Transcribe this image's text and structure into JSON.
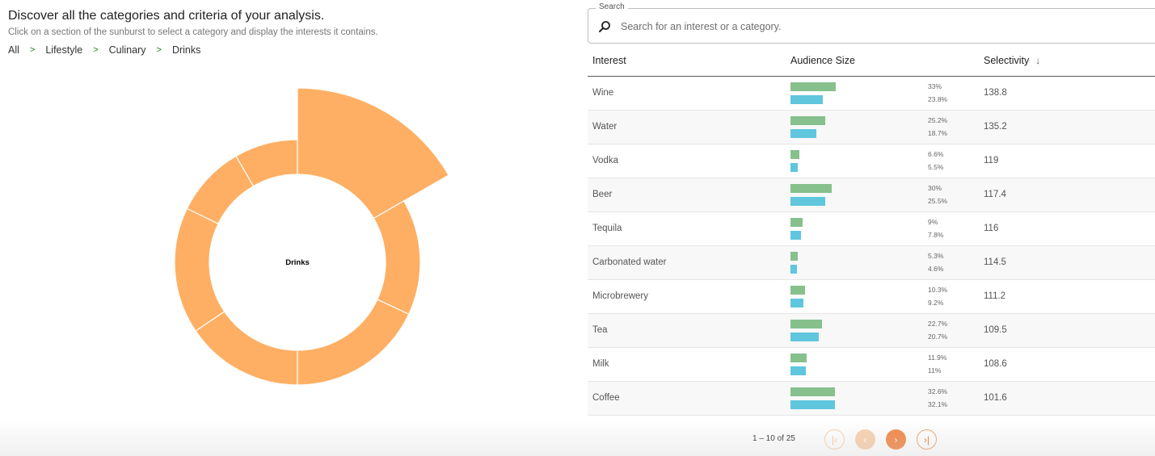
{
  "header": {
    "title": "Discover all the categories and criteria of your analysis.",
    "subtitle": "Click on a section of the sunburst to select a category and display the interests it contains."
  },
  "breadcrumb": {
    "items": [
      "All",
      "Lifestyle",
      "Culinary",
      "Drinks"
    ],
    "separator": ">"
  },
  "sunburst": {
    "center_label": "Drinks",
    "color": "#feaf63",
    "segment_count": 7,
    "selected_segment": 0
  },
  "search": {
    "legend": "Search",
    "placeholder": "Search for an interest or a category.",
    "value": "",
    "icon": "search-icon"
  },
  "table": {
    "columns": [
      "Interest",
      "Audience Size",
      "Selectivity"
    ],
    "sort_icon": "arrow-down-icon",
    "bar_colors": {
      "top": "#86c08d",
      "bottom": "#5fc6de"
    },
    "rows": [
      {
        "interest": "Wine",
        "pct_top": "33%",
        "pct_bottom": "23.8%",
        "selectivity": "138.8"
      },
      {
        "interest": "Water",
        "pct_top": "25.2%",
        "pct_bottom": "18.7%",
        "selectivity": "135.2"
      },
      {
        "interest": "Vodka",
        "pct_top": "6.6%",
        "pct_bottom": "5.5%",
        "selectivity": "119"
      },
      {
        "interest": "Beer",
        "pct_top": "30%",
        "pct_bottom": "25.5%",
        "selectivity": "117.4"
      },
      {
        "interest": "Tequila",
        "pct_top": "9%",
        "pct_bottom": "7.8%",
        "selectivity": "116"
      },
      {
        "interest": "Carbonated water",
        "pct_top": "5.3%",
        "pct_bottom": "4.6%",
        "selectivity": "114.5"
      },
      {
        "interest": "Microbrewery",
        "pct_top": "10.3%",
        "pct_bottom": "9.2%",
        "selectivity": "111.2"
      },
      {
        "interest": "Tea",
        "pct_top": "22.7%",
        "pct_bottom": "20.7%",
        "selectivity": "109.5"
      },
      {
        "interest": "Milk",
        "pct_top": "11.9%",
        "pct_bottom": "11%",
        "selectivity": "108.6"
      },
      {
        "interest": "Coffee",
        "pct_top": "32.6%",
        "pct_bottom": "32.1%",
        "selectivity": "101.6"
      }
    ]
  },
  "pagination": {
    "range": "1 – 10 of 25",
    "icons": [
      "first-page-icon",
      "previous-page-icon",
      "next-page-icon",
      "last-page-icon"
    ]
  }
}
